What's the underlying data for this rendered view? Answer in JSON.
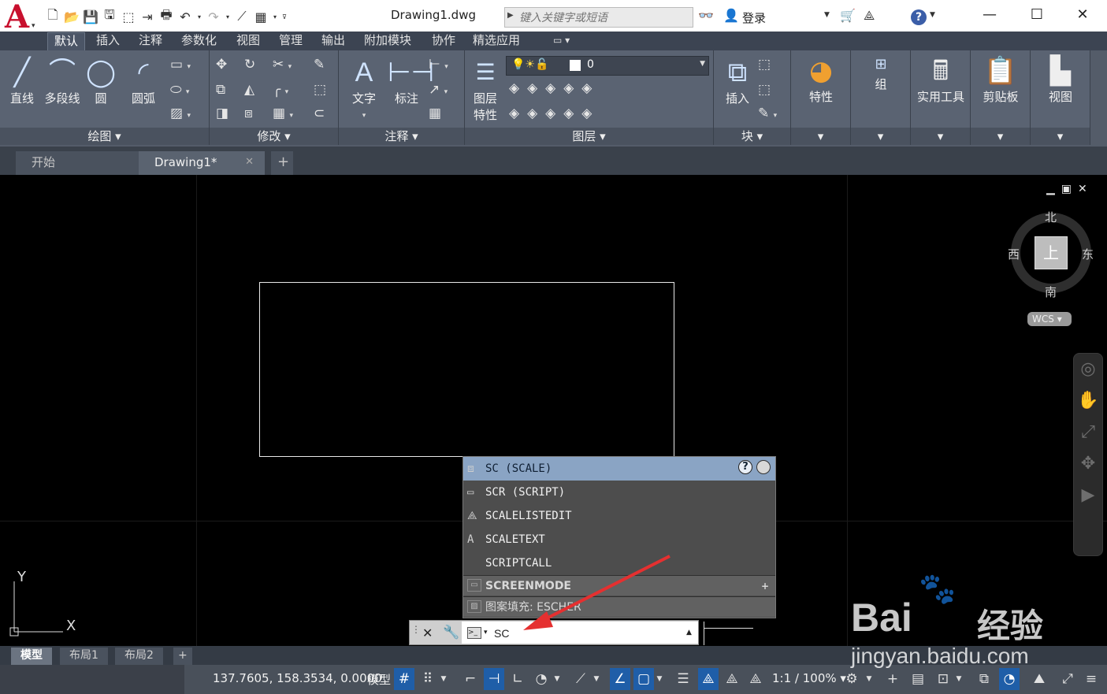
{
  "titlebar": {
    "document_title": "Drawing1.dwg",
    "search_placeholder": "键入关键字或短语",
    "login_label": "登录"
  },
  "menu_tabs": [
    "默认",
    "插入",
    "注释",
    "参数化",
    "视图",
    "管理",
    "输出",
    "附加模块",
    "协作",
    "精选应用"
  ],
  "ribbon": {
    "draw": {
      "line": "直线",
      "polyline": "多段线",
      "circle": "圆",
      "arc": "圆弧",
      "footer": "绘图"
    },
    "modify": {
      "footer": "修改"
    },
    "annotation": {
      "text": "文字",
      "dimension": "标注",
      "footer": "注释"
    },
    "layers": {
      "properties_line1": "图层",
      "properties_line2": "特性",
      "current_layer": "0",
      "footer": "图层"
    },
    "block": {
      "insert": "插入",
      "footer": "块"
    },
    "properties": {
      "label": "特性"
    },
    "groups": {
      "label": "组"
    },
    "utilities": {
      "label": "实用工具"
    },
    "clipboard": {
      "label": "剪贴板"
    },
    "view": {
      "label": "视图"
    }
  },
  "doc_tabs": {
    "start": "开始",
    "drawing": "Drawing1*"
  },
  "viewcube": {
    "north": "北",
    "south": "南",
    "east": "东",
    "west": "西",
    "face": "上",
    "wcs": "WCS"
  },
  "autocomplete": {
    "items": [
      {
        "label": "SC (SCALE)",
        "icon": "scale-icon"
      },
      {
        "label": "SCR (SCRIPT)",
        "icon": "script-icon"
      },
      {
        "label": "SCALELISTEDIT",
        "icon": "scalelist-icon"
      },
      {
        "label": "SCALETEXT",
        "icon": "scaletext-icon"
      },
      {
        "label": "SCRIPTCALL",
        "icon": ""
      }
    ],
    "groups": [
      {
        "label": "SCREENMODE",
        "icon": "screenmode-icon"
      },
      {
        "label": "图案填充: ESCHER",
        "icon": "hatch-icon"
      }
    ]
  },
  "command_line": {
    "value": "SC"
  },
  "ucs": {
    "x": "X",
    "y": "Y"
  },
  "layout_tabs": [
    "模型",
    "布局1",
    "布局2"
  ],
  "statusbar": {
    "coordinates": "137.7605, 158.3534, 0.0000",
    "model": "模型",
    "annotation_scale": "1:1 / 100%"
  },
  "watermark": {
    "brand": "Bai",
    "cn": "经验",
    "url": "jingyan.baidu.com"
  },
  "colors": {
    "accent": "#1f5ea8",
    "ribbon": "#545c69",
    "logo_red": "#c8102e",
    "highlight": "#8aa4c4"
  }
}
